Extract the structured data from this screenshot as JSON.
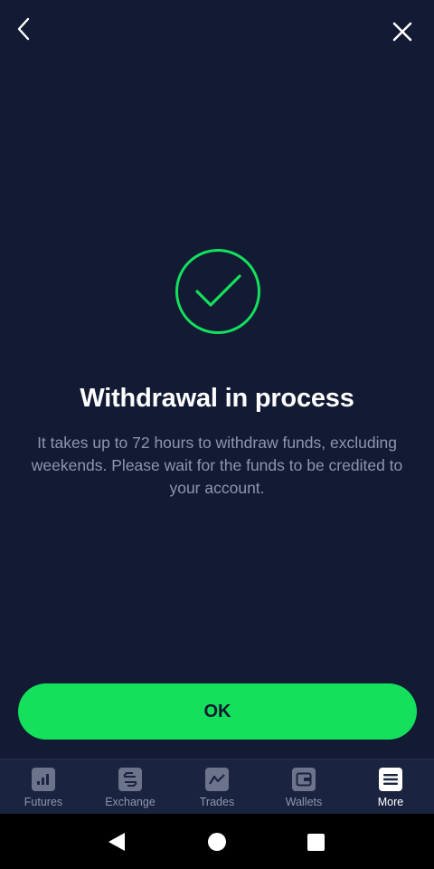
{
  "colors": {
    "background": "#121b33",
    "accent": "#14e05c",
    "tabbar": "#1a2440",
    "muted_text": "#8c96ad",
    "tab_icon_inactive": "#6b748a"
  },
  "header": {
    "back_icon": "chevron-left-icon",
    "close_icon": "close-icon"
  },
  "status": {
    "icon": "check-circle-icon",
    "title": "Withdrawal in process",
    "message": "It takes up to 72 hours to withdraw funds, excluding weekends. Please wait for the funds to be credited to your account."
  },
  "actions": {
    "ok_label": "OK"
  },
  "tabbar": {
    "items": [
      {
        "label": "Futures",
        "icon": "bar-chart-icon",
        "active": false
      },
      {
        "label": "Exchange",
        "icon": "exchange-icon",
        "active": false
      },
      {
        "label": "Trades",
        "icon": "trend-line-icon",
        "active": false
      },
      {
        "label": "Wallets",
        "icon": "wallet-icon",
        "active": false
      },
      {
        "label": "More",
        "icon": "menu-icon",
        "active": true
      }
    ]
  },
  "system_nav": {
    "back_icon": "triangle-back-icon",
    "home_icon": "circle-home-icon",
    "recents_icon": "square-recents-icon"
  }
}
